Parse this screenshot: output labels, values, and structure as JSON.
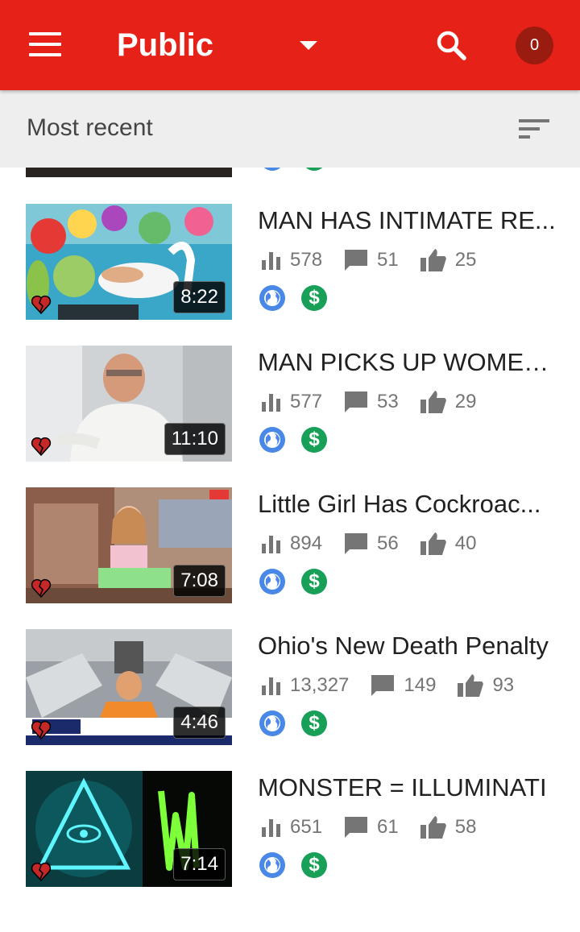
{
  "appbar": {
    "title": "Public",
    "notification_count": "0",
    "icons": [
      "menu-icon",
      "dropdown-arrow-icon",
      "search-icon"
    ]
  },
  "subbar": {
    "sort_label": "Most recent",
    "icons": [
      "sort-icon"
    ]
  },
  "colors": {
    "appbar": "#e62117",
    "notification": "#9a1b10",
    "globe_badge": "#4a88e8",
    "money_badge": "#18a058",
    "heart": "#c62828"
  },
  "videos": [
    {
      "title": "MAN HAS INTIMATE RE...",
      "duration": "8:22",
      "views": "578",
      "comments": "51",
      "likes": "25",
      "visibility_icon": "globe-icon",
      "monetization_icon": "dollar-icon"
    },
    {
      "title": "MAN PICKS UP WOMEN...",
      "duration": "11:10",
      "views": "577",
      "comments": "53",
      "likes": "29",
      "visibility_icon": "globe-icon",
      "monetization_icon": "dollar-icon"
    },
    {
      "title": "Little Girl Has Cockroac...",
      "duration": "7:08",
      "views": "894",
      "comments": "56",
      "likes": "40",
      "visibility_icon": "globe-icon",
      "monetization_icon": "dollar-icon"
    },
    {
      "title": "Ohio's New Death Penalty",
      "duration": "4:46",
      "views": "13,327",
      "comments": "149",
      "likes": "93",
      "visibility_icon": "globe-icon",
      "monetization_icon": "dollar-icon"
    },
    {
      "title": "MONSTER = ILLUMINATI",
      "duration": "7:14",
      "views": "651",
      "comments": "61",
      "likes": "58",
      "visibility_icon": "globe-icon",
      "monetization_icon": "dollar-icon"
    }
  ],
  "badge_text": {
    "money": "$"
  }
}
